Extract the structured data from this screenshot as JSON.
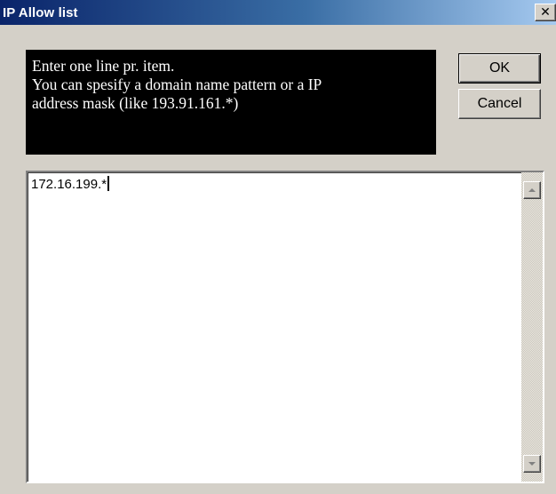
{
  "window": {
    "title": "IP Allow list",
    "close_glyph": "✕",
    "close_icon": "close-icon"
  },
  "info": {
    "lines": [
      "Enter one line pr. item.",
      "You can spesify a domain name pattern or a IP",
      "address mask (like 193.91.161.*)"
    ]
  },
  "buttons": {
    "ok_label": "OK",
    "cancel_label": "Cancel"
  },
  "editor": {
    "value": "172.16.199.*"
  },
  "scrollbar": {
    "up_icon": "arrow-up-icon",
    "down_icon": "arrow-down-icon"
  },
  "colors": {
    "title_bar_start": "#0a246a",
    "title_bar_end": "#a6caf0",
    "dialog_background": "#d4d0c8",
    "info_panel_background": "#000000",
    "info_panel_text": "#ffffff"
  }
}
